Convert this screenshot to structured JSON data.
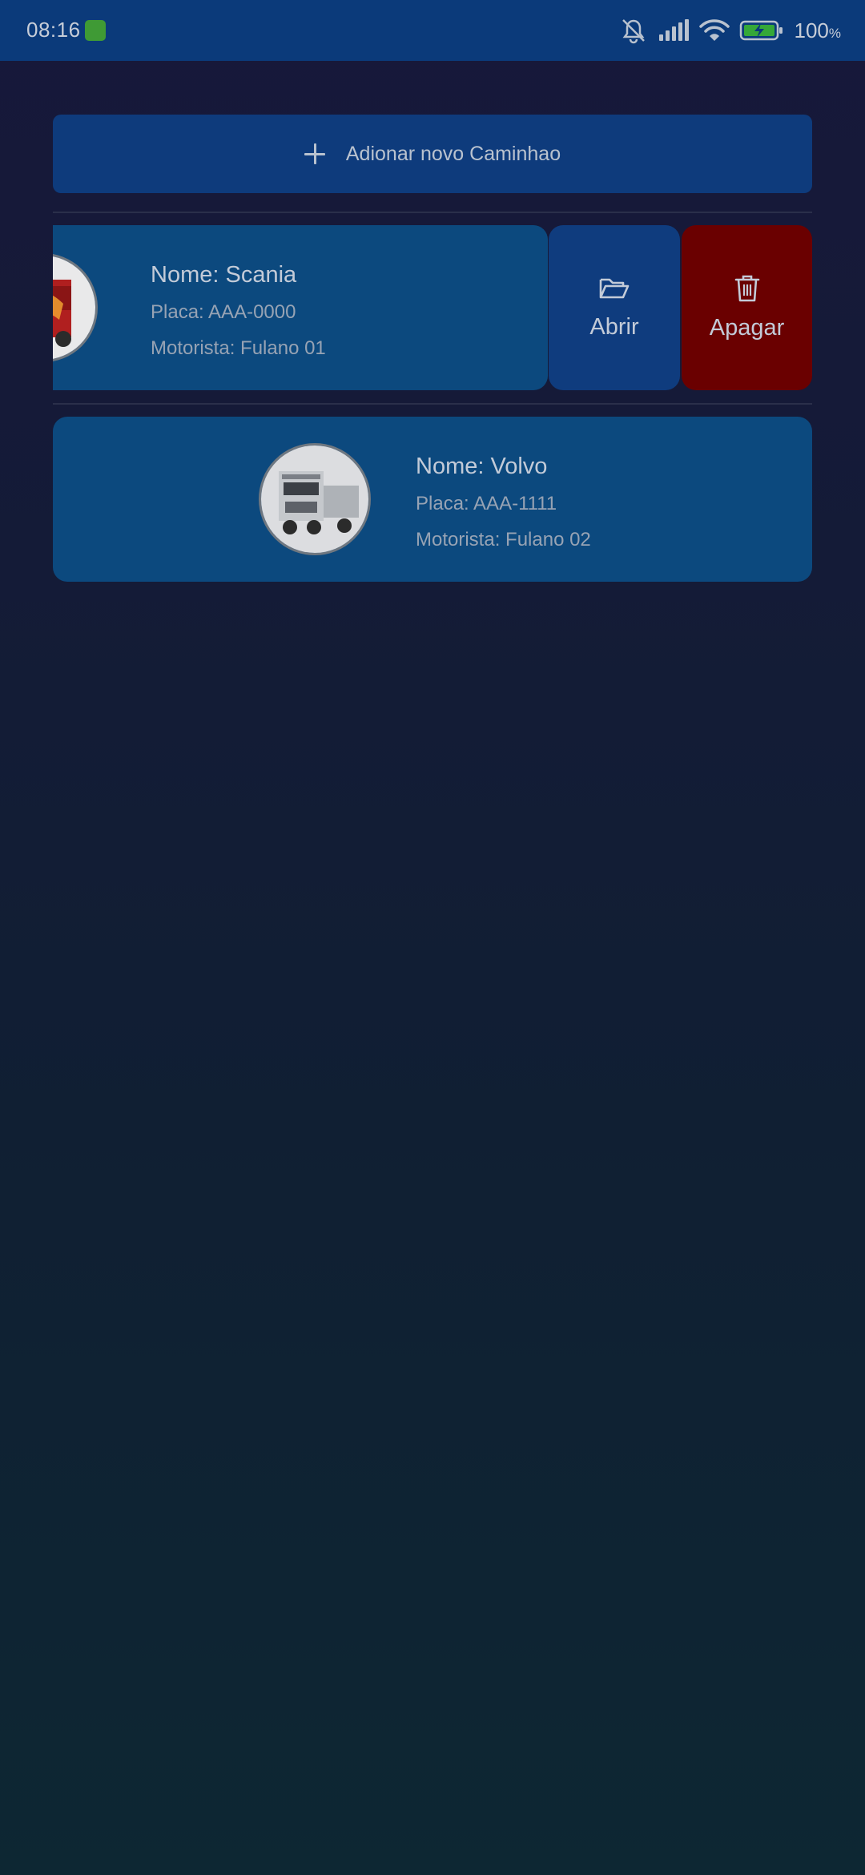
{
  "status_bar": {
    "time": "08:16",
    "battery_percent": "100",
    "battery_unit": "%"
  },
  "add_button": {
    "label": "Adionar novo Caminhao"
  },
  "trucks": [
    {
      "name": "Nome: Scania",
      "plate": "Placa: AAA-0000",
      "driver": "Motorista: Fulano 01",
      "image_color": "#b01f1f",
      "swiped": true
    },
    {
      "name": "Nome: Volvo",
      "plate": "Placa: AAA-1111",
      "driver": "Motorista: Fulano 02",
      "image_color": "#c9cdd2",
      "swiped": false
    }
  ],
  "row_actions": {
    "open_label": "Abrir",
    "delete_label": "Apagar",
    "open_icon": "folder-open-icon",
    "delete_icon": "trash-icon",
    "open_color": "#0f3c7e",
    "delete_color": "#6a0000"
  },
  "colors": {
    "status_bar": "#0b3a7a",
    "card": "#0c497e",
    "add_button": "#0e3b7c"
  }
}
